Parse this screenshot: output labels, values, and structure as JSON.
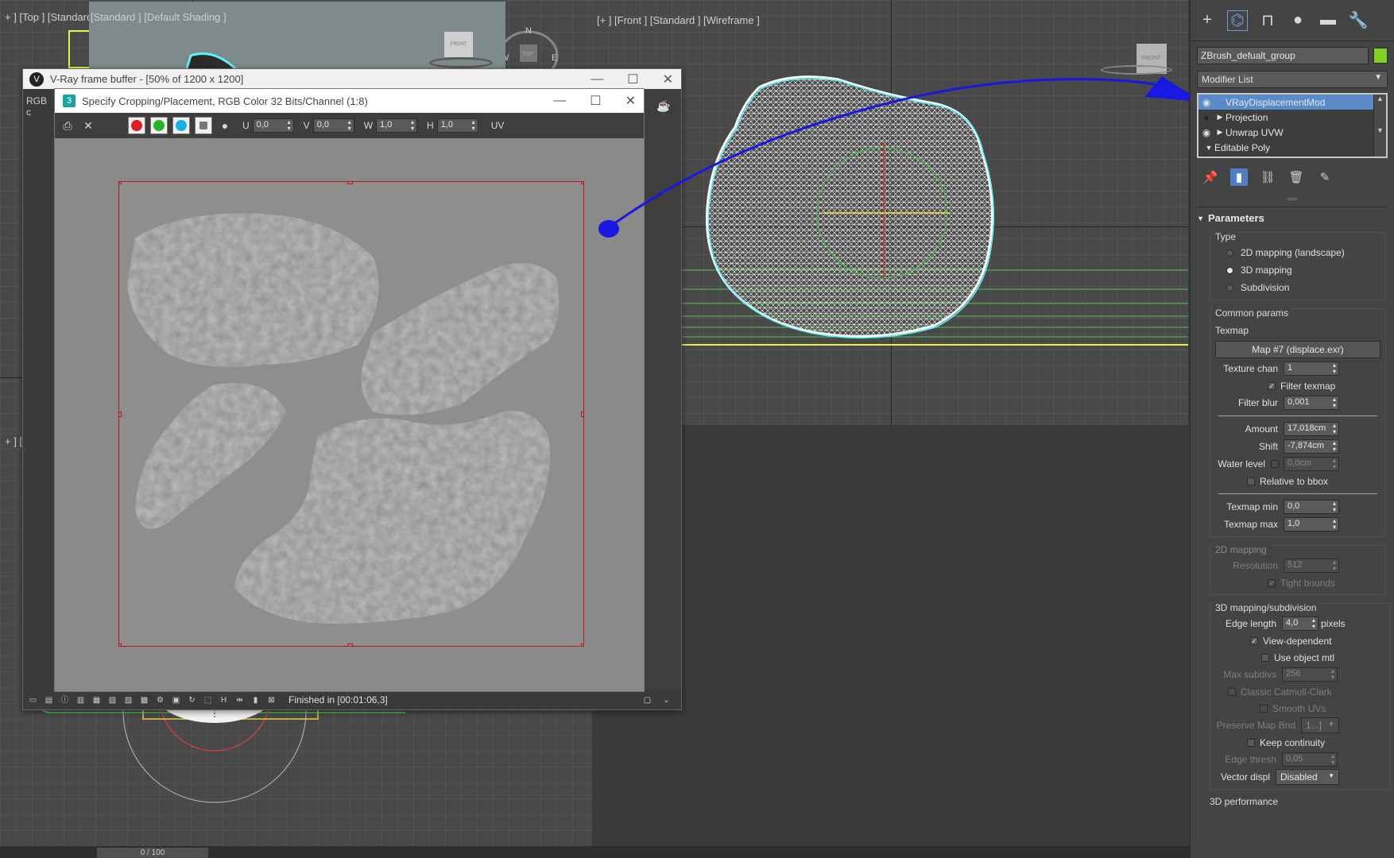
{
  "viewports": {
    "top_label": "+ ] [Top ] [Standard ] [Wireframe ]",
    "front_label": "[+ ] [Front ] [Standard ] [Wireframe ]",
    "persp_label": "[Standard ] [Default Shading ]",
    "left_edge_label": "+ ] [L",
    "compass_n": "N",
    "compass_w": "W",
    "compass_e": "E",
    "compass_top": "TOP",
    "front_cube": "FRONT"
  },
  "vfb": {
    "title": "V-Ray frame buffer - [50% of 1200 x 1200]",
    "channel": "RGB c",
    "status": "Finished in [00:01:06,3]"
  },
  "crop": {
    "title": "Specify Cropping/Placement, RGB Color 32 Bits/Channel (1:8)",
    "u_label": "U",
    "u_value": "0,0",
    "v_label": "V",
    "v_value": "0,0",
    "w_label": "W",
    "w_value": "1,0",
    "h_label": "H",
    "h_value": "1,0",
    "uv_label": "UV"
  },
  "panel": {
    "object_name": "ZBrush_defualt_group",
    "object_color": "#7ed321",
    "modifier_list": "Modifier List",
    "stack": [
      {
        "label": "VRayDisplacementMod",
        "selected": true
      },
      {
        "label": "Projection",
        "selected": false
      },
      {
        "label": "Unwrap UVW",
        "selected": false
      },
      {
        "label": "Editable Poly",
        "selected": false
      }
    ],
    "params": {
      "title": "Parameters",
      "type_label": "Type",
      "type_options": [
        "2D mapping (landscape)",
        "3D mapping",
        "Subdivision"
      ],
      "type_selected": "3D mapping",
      "common_label": "Common params",
      "texmap_label": "Texmap",
      "texmap_button": "Map #7 (displace.exr)",
      "texture_chan_label": "Texture chan",
      "texture_chan": "1",
      "filter_texmap": "Filter texmap",
      "filter_blur_label": "Filter blur",
      "filter_blur": "0,001",
      "amount_label": "Amount",
      "amount": "17,018cm",
      "shift_label": "Shift",
      "shift": "-7,874cm",
      "water_label": "Water level",
      "water": "0,0cm",
      "relative_bbox": "Relative to bbox",
      "texmap_min_label": "Texmap min",
      "texmap_min": "0,0",
      "texmap_max_label": "Texmap max",
      "texmap_max": "1,0",
      "map2d_label": "2D mapping",
      "resolution_label": "Resolution",
      "resolution": "512",
      "tight_bounds": "Tight bounds",
      "map3d_label": "3D mapping/subdivision",
      "edge_length_label": "Edge length",
      "edge_length": "4,0",
      "pixels": "pixels",
      "view_dependent": "View-dependent",
      "use_object_mtl": "Use object mtl",
      "max_subdivs_label": "Max subdivs",
      "max_subdivs": "256",
      "classic_cc": "Classic Catmull-Clark",
      "smooth_uvs": "Smooth UVs",
      "preserve_label": "Preserve Map Bnd",
      "preserve": "1...]",
      "keep_continuity": "Keep continuity",
      "edge_thresh_label": "Edge thresh",
      "edge_thresh": "0,05",
      "vector_label": "Vector displ",
      "vector": "Disabled",
      "perf_label": "3D performance"
    }
  },
  "bottom": {
    "frame": "0 / 100"
  }
}
